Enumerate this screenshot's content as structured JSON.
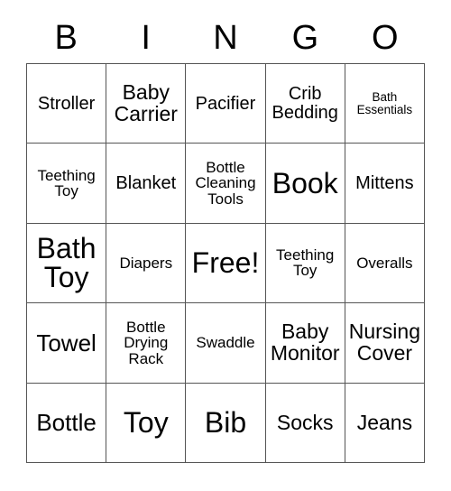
{
  "card": {
    "title": "BINGO",
    "header_letters": [
      "B",
      "I",
      "N",
      "G",
      "O"
    ],
    "border_color": "#555555",
    "text_color": "#000000",
    "background_color": "#ffffff",
    "rows": 5,
    "columns": 5,
    "cells": [
      {
        "text": "Stroller",
        "size": "md",
        "free": false
      },
      {
        "text": "Baby Carrier",
        "size": "lg",
        "free": false
      },
      {
        "text": "Pacifier",
        "size": "md",
        "free": false
      },
      {
        "text": "Crib Bedding",
        "size": "md",
        "free": false
      },
      {
        "text": "Bath Essentials",
        "size": "xs",
        "free": false
      },
      {
        "text": "Teething Toy",
        "size": "sm",
        "free": false
      },
      {
        "text": "Blanket",
        "size": "md",
        "free": false
      },
      {
        "text": "Bottle Cleaning Tools",
        "size": "sm",
        "free": false
      },
      {
        "text": "Book",
        "size": "xxl",
        "free": false
      },
      {
        "text": "Mittens",
        "size": "md",
        "free": false
      },
      {
        "text": "Bath Toy",
        "size": "xxl",
        "free": false
      },
      {
        "text": "Diapers",
        "size": "sm",
        "free": false
      },
      {
        "text": "Free!",
        "size": "xxl",
        "free": true
      },
      {
        "text": "Teething Toy",
        "size": "sm",
        "free": false
      },
      {
        "text": "Overalls",
        "size": "sm",
        "free": false
      },
      {
        "text": "Towel",
        "size": "xl",
        "free": false
      },
      {
        "text": "Bottle Drying Rack",
        "size": "sm",
        "free": false
      },
      {
        "text": "Swaddle",
        "size": "sm",
        "free": false
      },
      {
        "text": "Baby Monitor",
        "size": "lg",
        "free": false
      },
      {
        "text": "Nursing Cover",
        "size": "lg",
        "free": false
      },
      {
        "text": "Bottle",
        "size": "xl",
        "free": false
      },
      {
        "text": "Toy",
        "size": "xxl",
        "free": false
      },
      {
        "text": "Bib",
        "size": "xxl",
        "free": false
      },
      {
        "text": "Socks",
        "size": "lg",
        "free": false
      },
      {
        "text": "Jeans",
        "size": "lg",
        "free": false
      }
    ]
  }
}
